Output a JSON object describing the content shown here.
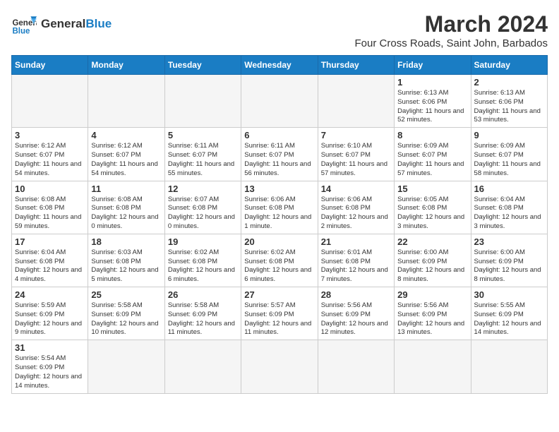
{
  "header": {
    "logo_general": "General",
    "logo_blue": "Blue",
    "month_title": "March 2024",
    "subtitle": "Four Cross Roads, Saint John, Barbados"
  },
  "days_of_week": [
    "Sunday",
    "Monday",
    "Tuesday",
    "Wednesday",
    "Thursday",
    "Friday",
    "Saturday"
  ],
  "weeks": [
    [
      {
        "day": null,
        "info": null
      },
      {
        "day": null,
        "info": null
      },
      {
        "day": null,
        "info": null
      },
      {
        "day": null,
        "info": null
      },
      {
        "day": null,
        "info": null
      },
      {
        "day": "1",
        "info": "Sunrise: 6:13 AM\nSunset: 6:06 PM\nDaylight: 11 hours and 52 minutes."
      },
      {
        "day": "2",
        "info": "Sunrise: 6:13 AM\nSunset: 6:06 PM\nDaylight: 11 hours and 53 minutes."
      }
    ],
    [
      {
        "day": "3",
        "info": "Sunrise: 6:12 AM\nSunset: 6:07 PM\nDaylight: 11 hours and 54 minutes."
      },
      {
        "day": "4",
        "info": "Sunrise: 6:12 AM\nSunset: 6:07 PM\nDaylight: 11 hours and 54 minutes."
      },
      {
        "day": "5",
        "info": "Sunrise: 6:11 AM\nSunset: 6:07 PM\nDaylight: 11 hours and 55 minutes."
      },
      {
        "day": "6",
        "info": "Sunrise: 6:11 AM\nSunset: 6:07 PM\nDaylight: 11 hours and 56 minutes."
      },
      {
        "day": "7",
        "info": "Sunrise: 6:10 AM\nSunset: 6:07 PM\nDaylight: 11 hours and 57 minutes."
      },
      {
        "day": "8",
        "info": "Sunrise: 6:09 AM\nSunset: 6:07 PM\nDaylight: 11 hours and 57 minutes."
      },
      {
        "day": "9",
        "info": "Sunrise: 6:09 AM\nSunset: 6:07 PM\nDaylight: 11 hours and 58 minutes."
      }
    ],
    [
      {
        "day": "10",
        "info": "Sunrise: 6:08 AM\nSunset: 6:08 PM\nDaylight: 11 hours and 59 minutes."
      },
      {
        "day": "11",
        "info": "Sunrise: 6:08 AM\nSunset: 6:08 PM\nDaylight: 12 hours and 0 minutes."
      },
      {
        "day": "12",
        "info": "Sunrise: 6:07 AM\nSunset: 6:08 PM\nDaylight: 12 hours and 0 minutes."
      },
      {
        "day": "13",
        "info": "Sunrise: 6:06 AM\nSunset: 6:08 PM\nDaylight: 12 hours and 1 minute."
      },
      {
        "day": "14",
        "info": "Sunrise: 6:06 AM\nSunset: 6:08 PM\nDaylight: 12 hours and 2 minutes."
      },
      {
        "day": "15",
        "info": "Sunrise: 6:05 AM\nSunset: 6:08 PM\nDaylight: 12 hours and 3 minutes."
      },
      {
        "day": "16",
        "info": "Sunrise: 6:04 AM\nSunset: 6:08 PM\nDaylight: 12 hours and 3 minutes."
      }
    ],
    [
      {
        "day": "17",
        "info": "Sunrise: 6:04 AM\nSunset: 6:08 PM\nDaylight: 12 hours and 4 minutes."
      },
      {
        "day": "18",
        "info": "Sunrise: 6:03 AM\nSunset: 6:08 PM\nDaylight: 12 hours and 5 minutes."
      },
      {
        "day": "19",
        "info": "Sunrise: 6:02 AM\nSunset: 6:08 PM\nDaylight: 12 hours and 6 minutes."
      },
      {
        "day": "20",
        "info": "Sunrise: 6:02 AM\nSunset: 6:08 PM\nDaylight: 12 hours and 6 minutes."
      },
      {
        "day": "21",
        "info": "Sunrise: 6:01 AM\nSunset: 6:08 PM\nDaylight: 12 hours and 7 minutes."
      },
      {
        "day": "22",
        "info": "Sunrise: 6:00 AM\nSunset: 6:09 PM\nDaylight: 12 hours and 8 minutes."
      },
      {
        "day": "23",
        "info": "Sunrise: 6:00 AM\nSunset: 6:09 PM\nDaylight: 12 hours and 8 minutes."
      }
    ],
    [
      {
        "day": "24",
        "info": "Sunrise: 5:59 AM\nSunset: 6:09 PM\nDaylight: 12 hours and 9 minutes."
      },
      {
        "day": "25",
        "info": "Sunrise: 5:58 AM\nSunset: 6:09 PM\nDaylight: 12 hours and 10 minutes."
      },
      {
        "day": "26",
        "info": "Sunrise: 5:58 AM\nSunset: 6:09 PM\nDaylight: 12 hours and 11 minutes."
      },
      {
        "day": "27",
        "info": "Sunrise: 5:57 AM\nSunset: 6:09 PM\nDaylight: 12 hours and 11 minutes."
      },
      {
        "day": "28",
        "info": "Sunrise: 5:56 AM\nSunset: 6:09 PM\nDaylight: 12 hours and 12 minutes."
      },
      {
        "day": "29",
        "info": "Sunrise: 5:56 AM\nSunset: 6:09 PM\nDaylight: 12 hours and 13 minutes."
      },
      {
        "day": "30",
        "info": "Sunrise: 5:55 AM\nSunset: 6:09 PM\nDaylight: 12 hours and 14 minutes."
      }
    ],
    [
      {
        "day": "31",
        "info": "Sunrise: 5:54 AM\nSunset: 6:09 PM\nDaylight: 12 hours and 14 minutes."
      },
      {
        "day": null,
        "info": null
      },
      {
        "day": null,
        "info": null
      },
      {
        "day": null,
        "info": null
      },
      {
        "day": null,
        "info": null
      },
      {
        "day": null,
        "info": null
      },
      {
        "day": null,
        "info": null
      }
    ]
  ]
}
